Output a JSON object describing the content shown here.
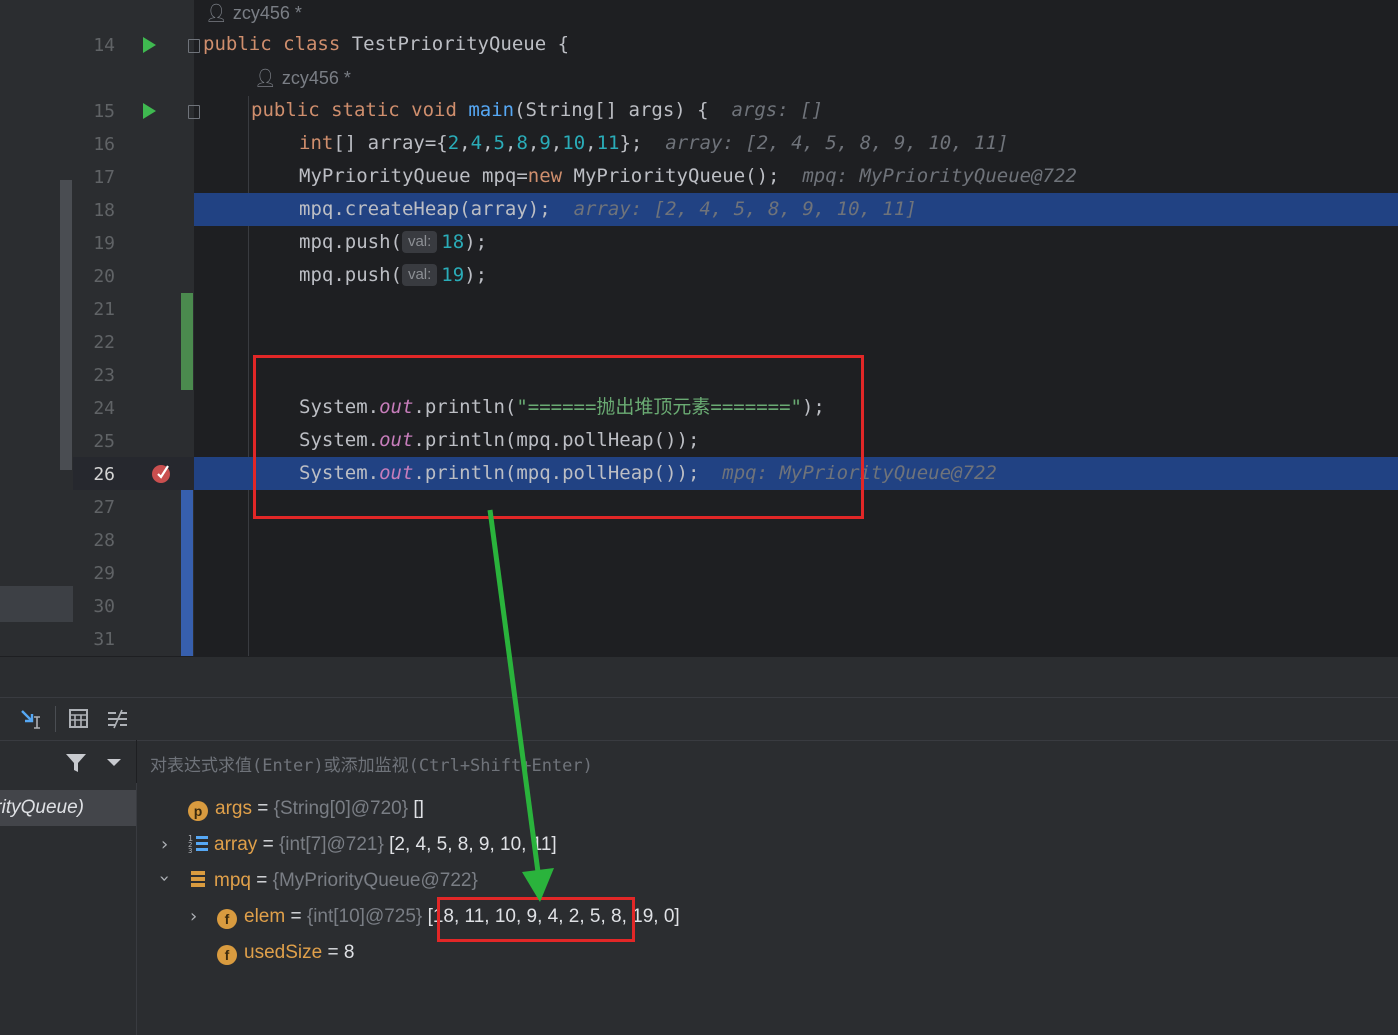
{
  "editor": {
    "author_label": "zcy456 *",
    "line_numbers": [
      "14",
      "15",
      "16",
      "17",
      "18",
      "19",
      "20",
      "21",
      "22",
      "23",
      "24",
      "25",
      "26",
      "27",
      "28",
      "29",
      "30",
      "31"
    ],
    "class_decl": {
      "kw": "public class ",
      "name": "TestPriorityQueue {"
    },
    "main_decl": {
      "kw": "public static void ",
      "name": "main",
      "rest": "(String[] args) {",
      "hint": "args: []"
    },
    "line16": {
      "kw": "int",
      "rest": "[] array={",
      "nums": [
        "2",
        "4",
        "5",
        "8",
        "9",
        "10",
        "11"
      ],
      "end": "};",
      "hint": "array: [2, 4, 5, 8, 9, 10, 11]"
    },
    "line17": {
      "pre": "MyPriorityQueue mpq=",
      "kw": "new",
      "post": " MyPriorityQueue();",
      "hint": "mpq: MyPriorityQueue@722"
    },
    "line18": {
      "code": "mpq.createHeap(array);",
      "hint": "array: [2, 4, 5, 8, 9, 10, 11]"
    },
    "line19": {
      "pre": "mpq.push(",
      "param": "val:",
      "num": "18",
      "post": ");"
    },
    "line20": {
      "pre": "mpq.push(",
      "param": "val:",
      "num": "19",
      "post": ");"
    },
    "line24": {
      "pre": "System.",
      "field": "out",
      "mid": ".println(",
      "str": "\"======抛出堆顶元素=======\"",
      "post": ");"
    },
    "line25": {
      "pre": "System.",
      "field": "out",
      "post": ".println(mpq.pollHeap());"
    },
    "line26": {
      "pre": "System.",
      "field": "out",
      "post": ".println(mpq.pollHeap());",
      "hint": "mpq: MyPriorityQueue@722"
    }
  },
  "debugger": {
    "eval_placeholder": "对表达式求值(Enter)或添加监视(Ctrl+Shift+Enter)",
    "frame_selected": "PriorityQueue)",
    "variables": [
      {
        "badge": "p",
        "name": "args",
        "type": "{String[0]@720}",
        "value": "[]"
      },
      {
        "name": "array",
        "type": "{int[7]@721}",
        "value": "[2, 4, 5, 8, 9, 10, 11]"
      },
      {
        "name": "mpq",
        "type": "{MyPriorityQueue@722}",
        "value": ""
      },
      {
        "badge": "f",
        "name": "elem",
        "type": "{int[10]@725}",
        "value": "[18, 11, 10, 9, 4, 2, 5, 8, 19, 0]"
      },
      {
        "badge": "f",
        "name": "usedSize",
        "type": "",
        "value": "8"
      }
    ]
  },
  "colors": {
    "highlight": "#214283",
    "annotation_red": "#e22727",
    "arrow_green": "#2ab33c"
  }
}
